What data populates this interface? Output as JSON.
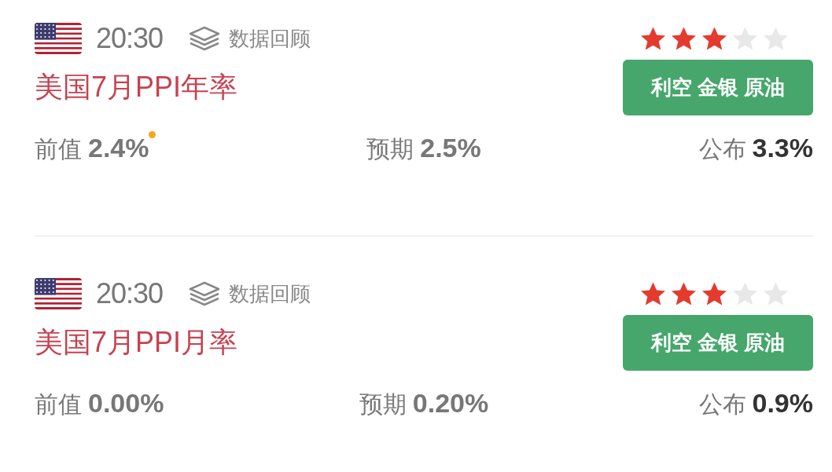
{
  "events": [
    {
      "time": "20:30",
      "review": "数据回顾",
      "stars": 3,
      "title": "美国7月PPI年率",
      "tag": "利空 金银 原油",
      "previous_label": "前值",
      "previous": "2.4%",
      "previous_revised": true,
      "forecast_label": "预期",
      "forecast": "2.5%",
      "actual_label": "公布",
      "actual": "3.3%"
    },
    {
      "time": "20:30",
      "review": "数据回顾",
      "stars": 3,
      "title": "美国7月PPI月率",
      "tag": "利空 金银 原油",
      "previous_label": "前值",
      "previous": "0.00%",
      "previous_revised": false,
      "forecast_label": "预期",
      "forecast": "0.20%",
      "actual_label": "公布",
      "actual": "0.9%"
    }
  ]
}
